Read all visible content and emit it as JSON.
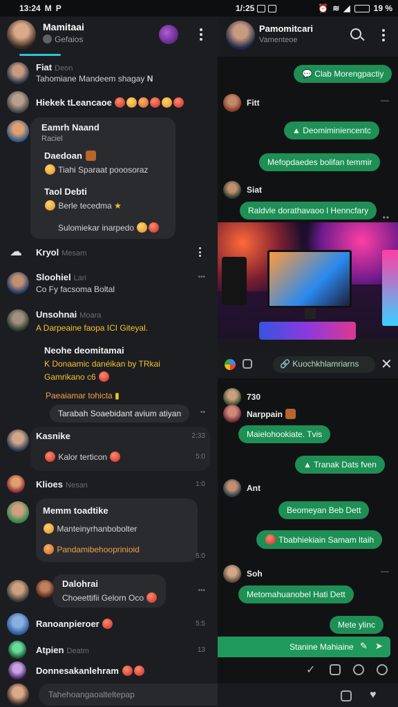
{
  "status_left": {
    "time": "13:24",
    "icons": [
      "M",
      "P"
    ]
  },
  "status_right": {
    "time": "1/:25",
    "battery": "19 %"
  },
  "left": {
    "header": {
      "name": "Mamitaai",
      "sub": "Gefaios"
    },
    "rows": [
      {
        "name": "Fiat",
        "name_dim": "Deon",
        "text": "Tahomiane Mandeem shagay"
      },
      {
        "name": "Hiekek tLeancaoe"
      },
      {
        "name": "Eamrh Naand",
        "sub": "Raciel",
        "card": [
          {
            "title": "Daedoan",
            "line": "Tiahi   Sparaat pooosoraz"
          },
          {
            "title": "Taol Debti",
            "line": "Berle tecedma"
          },
          {
            "line": "Sulomiekar inarpedo"
          }
        ]
      },
      {
        "name": "Kryol",
        "name_dim": "Mesam"
      },
      {
        "name": "Sloohiel",
        "name_dim": "Lari",
        "text": "Co Fy facsoma   Boltal"
      },
      {
        "name": "Unsohnai",
        "name_dim": "Moara",
        "text": "A Darpeaine faopa ICI Giteyal."
      },
      {
        "title": "Neohe deomitamai",
        "line1": "K   Donaamic danéikan by TRkai",
        "line2": "Gamrikano c6",
        "line3": "Paeaiamar tohicta",
        "bubble": "Tarabah Soaebidant avium atiyan"
      },
      {
        "name": "Kasnike",
        "time": "2:33",
        "text": "Kalor terticon",
        "time2": "5:0"
      },
      {
        "name": "Klioes",
        "name_dim": "Nesan",
        "time": "1:0"
      },
      {
        "card_title": "Memm toadtike",
        "line1": "Manteinyrhanbobolter",
        "line2": "Pandamibehooprinioid",
        "time": "5:0"
      },
      {
        "name": "Dalohrai",
        "text": "Choeettifii Gelorn Oco"
      },
      {
        "name": "Ranoanpieroer",
        "time": "5:5"
      },
      {
        "name": "Atpien",
        "name_dim": "Deatm",
        "time": "13"
      },
      {
        "name": "Donnesakanlehram"
      }
    ],
    "input": {
      "placeholder": "Tahehoangaoalteltepap"
    }
  },
  "right": {
    "header": {
      "name": "Pamomitcari",
      "sub": "Vamenteoe"
    },
    "messages": [
      {
        "type": "out",
        "text": "Clab Morengpactiy"
      },
      {
        "type": "sender",
        "name": "Fitt"
      },
      {
        "type": "out",
        "text": "Deomiminiencentc"
      },
      {
        "type": "out",
        "text": "Mefopdaedes bolifan temmir"
      },
      {
        "type": "sender",
        "name": "Siat"
      },
      {
        "type": "out",
        "text": "Raldvle dorathavaoo l Henncfary"
      },
      {
        "type": "image_bar",
        "text": "Kuochkhlamriarns"
      },
      {
        "type": "sender",
        "name": "730"
      },
      {
        "type": "sender",
        "name": "Narppain"
      },
      {
        "type": "out",
        "text": "Maielohookiate.   Tvis"
      },
      {
        "type": "out",
        "text": "Tranak Dats fven"
      },
      {
        "type": "sender",
        "name": "Ant"
      },
      {
        "type": "out",
        "text": "Beomeyan   Beb Dett"
      },
      {
        "type": "out",
        "text": "Tbabhiekiain Samam ltaih"
      },
      {
        "type": "sender",
        "name": "Soh"
      },
      {
        "type": "out",
        "text": "Metomahuanobel Hati Dett"
      },
      {
        "type": "out",
        "text": "Mete ylinc"
      }
    ],
    "send_bar": {
      "text": "Stanine Mahiaine"
    }
  }
}
